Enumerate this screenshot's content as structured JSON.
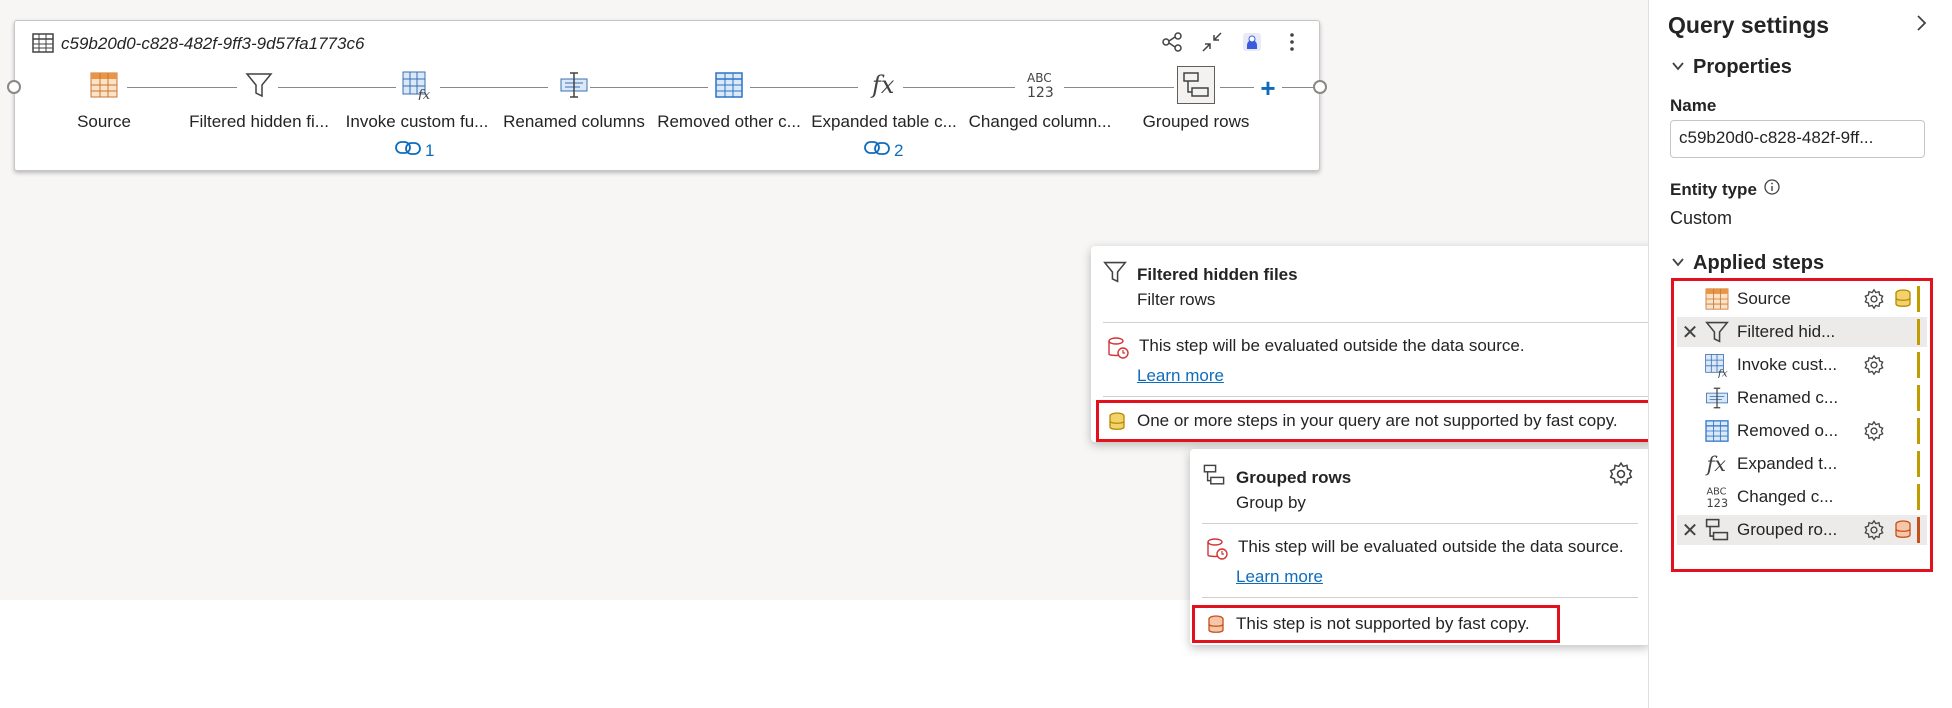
{
  "query": {
    "title": "c59b20d0-c828-482f-9ff3-9d57fa1773c6",
    "steps": [
      {
        "label": "Source",
        "icon": "table-source-icon"
      },
      {
        "label": "Filtered hidden fi...",
        "icon": "filter-icon"
      },
      {
        "label": "Invoke custom fu...",
        "icon": "function-table-icon"
      },
      {
        "label": "Renamed columns",
        "icon": "rename-columns-icon"
      },
      {
        "label": "Removed other c...",
        "icon": "grid-table-icon"
      },
      {
        "label": "Expanded table c...",
        "icon": "fx-icon"
      },
      {
        "label": "Changed column...",
        "icon": "abc123-icon"
      },
      {
        "label": "Grouped rows",
        "icon": "group-by-icon"
      }
    ],
    "link_counts": [
      "1",
      "2"
    ]
  },
  "tooltip1": {
    "title": "Filtered hidden files",
    "subtitle": "Filter rows",
    "eval_note": "This step will be evaluated outside the data source.",
    "learn_more": "Learn more",
    "fast_copy_note": "One or more steps in your query are not supported by fast copy."
  },
  "tooltip2": {
    "title": "Grouped rows",
    "subtitle": "Group by",
    "eval_note": "This step will be evaluated outside the data source.",
    "learn_more": "Learn more",
    "fast_copy_note": "This step is not supported by fast copy."
  },
  "panel": {
    "title": "Query settings",
    "properties_label": "Properties",
    "name_label": "Name",
    "name_value": "c59b20d0-c828-482f-9ff...",
    "entity_type_label": "Entity type",
    "entity_type_value": "Custom",
    "applied_steps_label": "Applied steps",
    "applied_steps": [
      {
        "label": "Source"
      },
      {
        "label": "Filtered hid..."
      },
      {
        "label": "Invoke cust..."
      },
      {
        "label": "Renamed c..."
      },
      {
        "label": "Removed o..."
      },
      {
        "label": "Expanded t..."
      },
      {
        "label": "Changed c..."
      },
      {
        "label": "Grouped ro..."
      }
    ]
  },
  "colors": {
    "accent": "#0f6cbd",
    "highlight": "#e3101e",
    "warning_gold": "#c19c00",
    "error_orange": "#d13438"
  }
}
